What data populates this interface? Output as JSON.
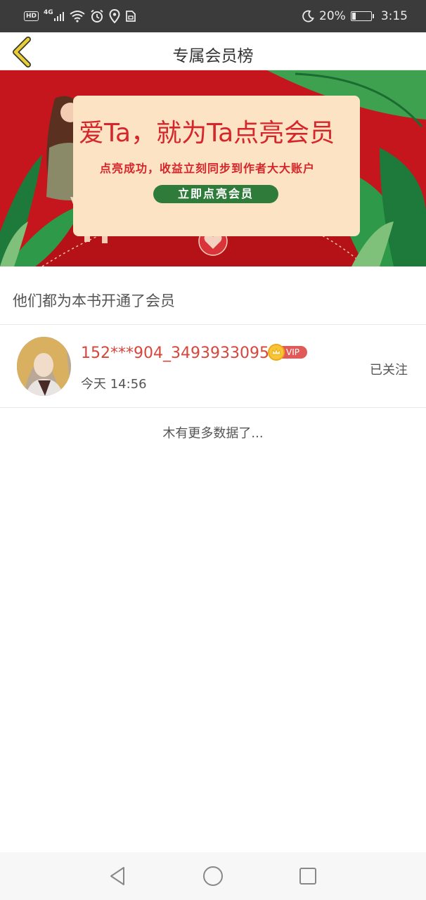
{
  "status_bar": {
    "hd": "HD",
    "network": "4G",
    "battery_percent": "20%",
    "battery_level": 0.2,
    "time": "3:15",
    "icons": [
      "hd-icon",
      "signal-icon",
      "wifi-icon",
      "alarm-icon",
      "location-icon",
      "sim-icon",
      "moon-icon",
      "battery-icon"
    ]
  },
  "header": {
    "title": "专属会员榜",
    "back_icon": "chevron-left-icon",
    "accent_color": "#e8cf3a"
  },
  "banner": {
    "title": "爱Ta，就为Ta点亮会员",
    "subtitle": "点亮成功，收益立刻同步到作者大大账户",
    "button_label": "立即点亮会员",
    "background_color": "#c4161c",
    "card_color": "#fbe3c4",
    "button_color": "#2f7b3a"
  },
  "section": {
    "heading": "他们都为本书开通了会员"
  },
  "members": [
    {
      "username": "152***904_3493933095",
      "vip_label": "VIP",
      "time": "今天 14:56",
      "follow_status": "已关注"
    }
  ],
  "list_footer": "木有更多数据了...",
  "nav_bar": {
    "icons": [
      "back-triangle-icon",
      "home-circle-icon",
      "recents-square-icon"
    ]
  }
}
